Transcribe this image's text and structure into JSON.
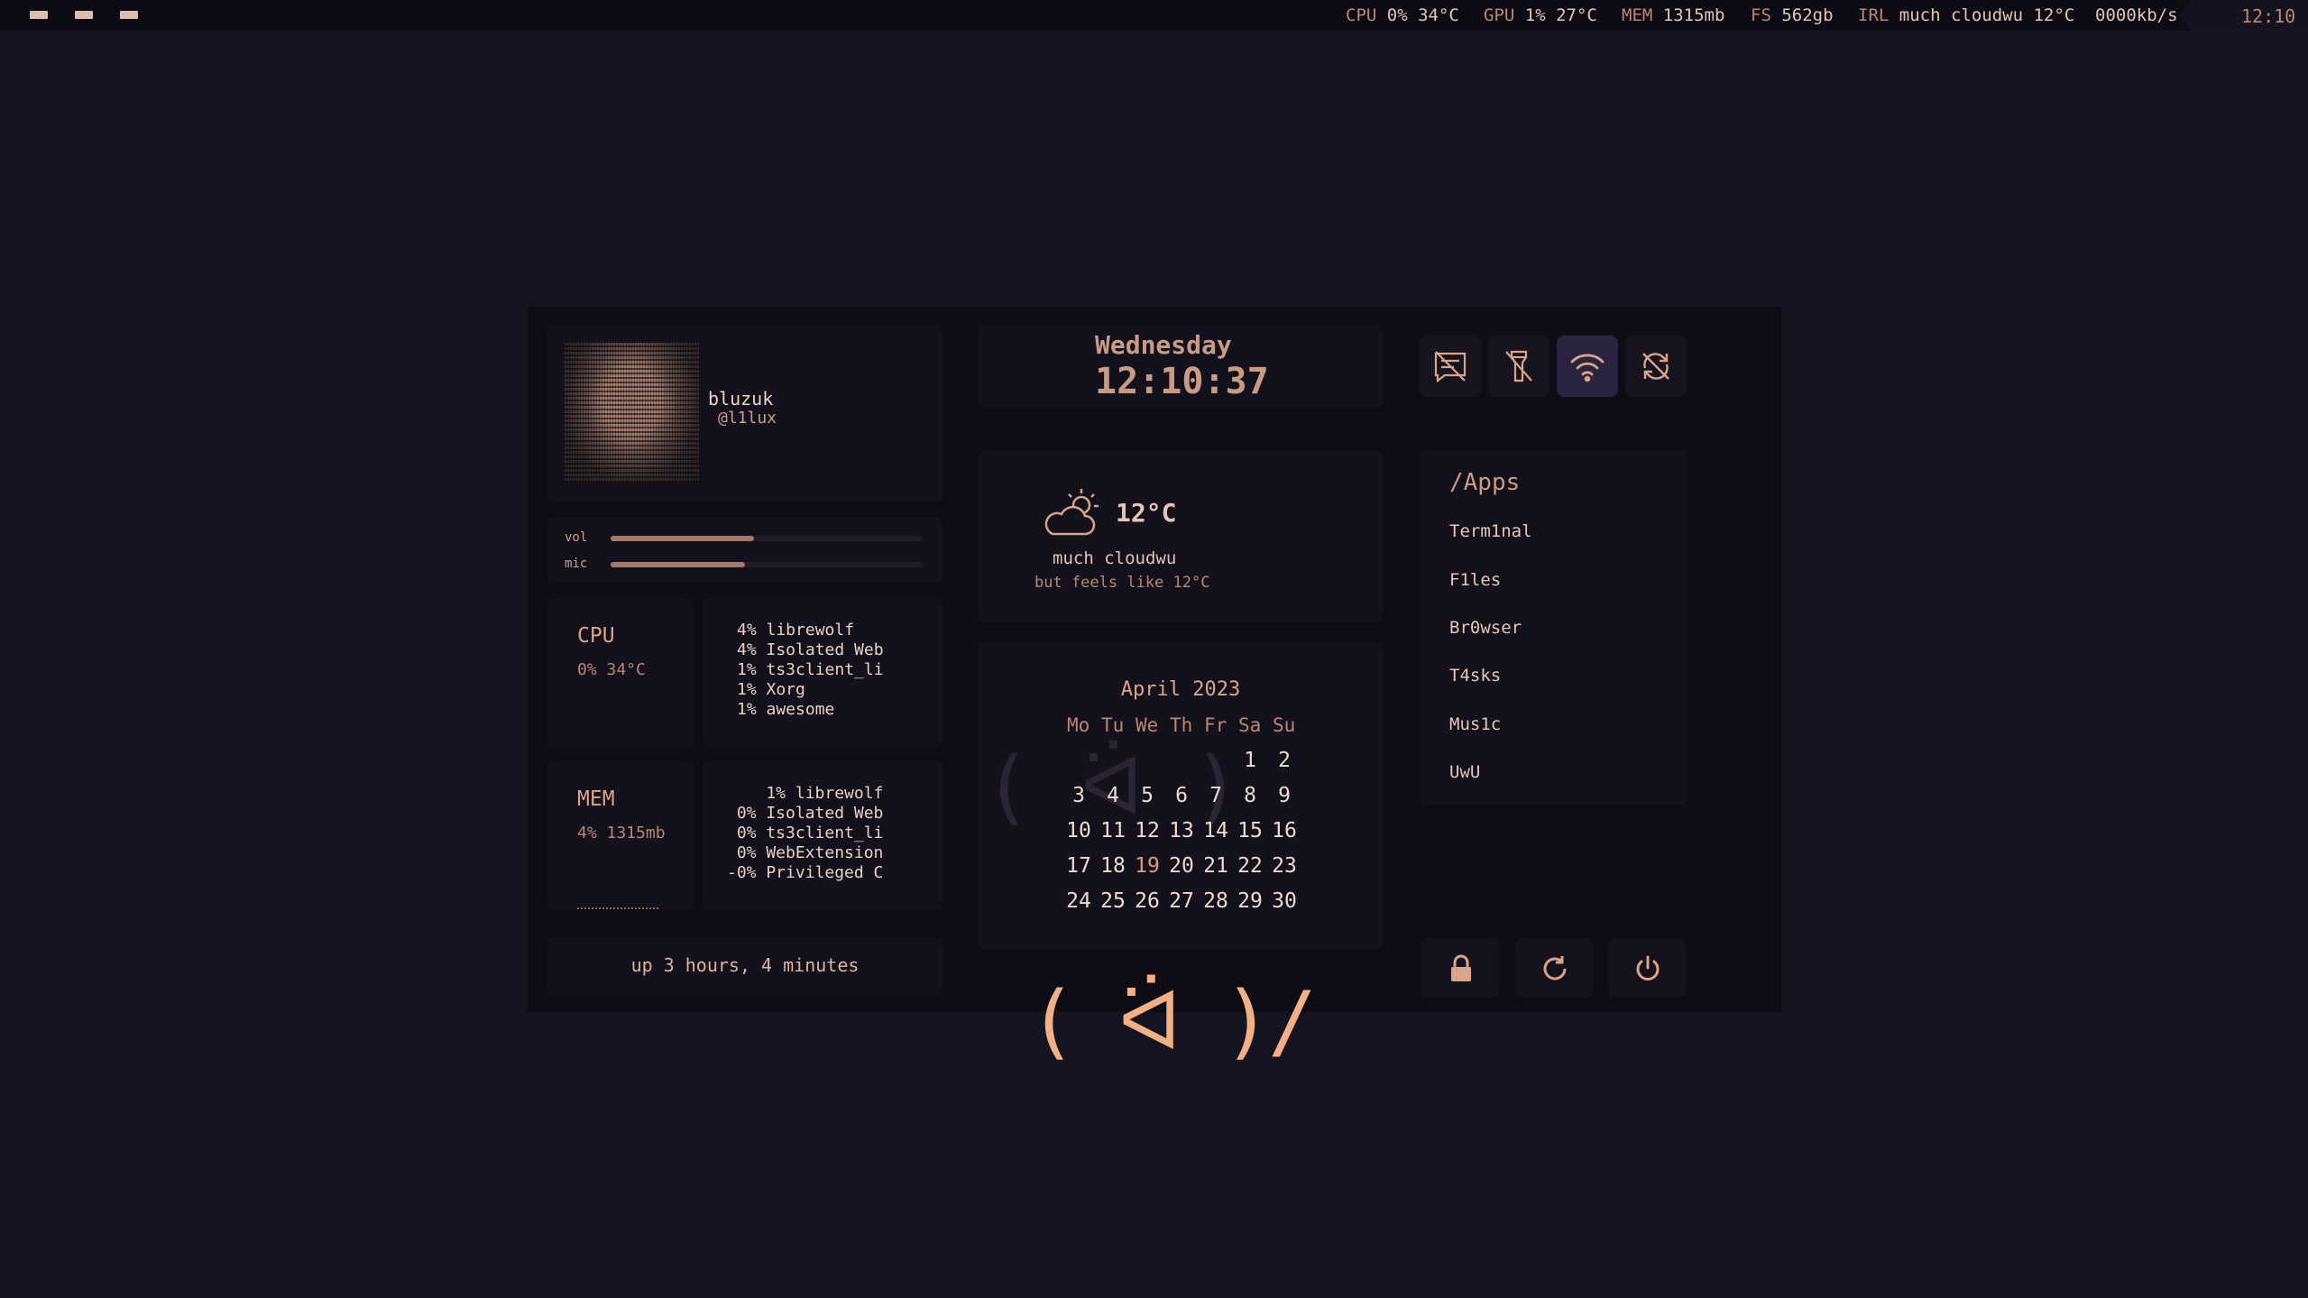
{
  "topbar": {
    "tags": [
      "tag-1",
      "tag-2",
      "tag-3"
    ],
    "cpu_key": "CPU",
    "cpu_val": "0% 34°C",
    "gpu_key": "GPU",
    "gpu_val": "1% 27°C",
    "mem_key": "MEM",
    "mem_val": "1315mb",
    "fs_key": "FS",
    "fs_val": "562gb",
    "irl_key": "IRL",
    "irl_val": "much cloudwu 12°C",
    "net": "0000kb/s",
    "clock": "12:10"
  },
  "profile": {
    "name": "bluzuk",
    "handle": "@l1lux"
  },
  "sliders": {
    "vol_label": "vol",
    "vol_level": 0.46,
    "mic_label": "mic",
    "mic_level": 0.43
  },
  "cpu": {
    "title": "CPU",
    "value": "0% 34°C",
    "processes": [
      "4% librewolf",
      "4% Isolated Web",
      "1% ts3client_li",
      "1% Xorg",
      "1% awesome"
    ]
  },
  "mem": {
    "title": "MEM",
    "value": "4% 1315mb",
    "processes": [
      "1% librewolf",
      "0% Isolated Web",
      "0% ts3client_li",
      "0% WebExtension",
      "-0% Privileged C"
    ]
  },
  "uptime": "up 3 hours, 4 minutes",
  "clock_card": {
    "day": "Wednesday",
    "time": "12:10:37"
  },
  "weather": {
    "temp": "12°C",
    "desc": "much cloudwu",
    "feels": "but feels like 12°C",
    "icon": "cloud-sun-icon"
  },
  "calendar": {
    "title": "April 2023",
    "weekdays": [
      "Mo",
      "Tu",
      "We",
      "Th",
      "Fr",
      "Sa",
      "Su"
    ],
    "weeks": [
      [
        "",
        "",
        "",
        "",
        "",
        "1",
        "2"
      ],
      [
        "3",
        "4",
        "5",
        "6",
        "7",
        "8",
        "9"
      ],
      [
        "10",
        "11",
        "12",
        "13",
        "14",
        "15",
        "16"
      ],
      [
        "17",
        "18",
        "19",
        "20",
        "21",
        "22",
        "23"
      ],
      [
        "24",
        "25",
        "26",
        "27",
        "28",
        "29",
        "30"
      ]
    ],
    "today": "19"
  },
  "quick_toggles": [
    {
      "icon": "notifications-off-icon",
      "active": false
    },
    {
      "icon": "flashlight-off-icon",
      "active": false
    },
    {
      "icon": "wifi-icon",
      "active": true
    },
    {
      "icon": "sync-off-icon",
      "active": false
    }
  ],
  "apps": {
    "title": "/Apps",
    "items": [
      "Term1nal",
      "F1les",
      "Br0wser",
      "T4sks",
      "Mus1c",
      "UwU"
    ]
  },
  "power": [
    "lock-icon",
    "restart-icon",
    "power-icon"
  ],
  "kaomoji": "( ᐛ )/",
  "colors": {
    "accent": "#d9a58a",
    "bg": "#171422",
    "panel": "#0e0c15",
    "card": "#13111c",
    "active": "#2a2440"
  }
}
